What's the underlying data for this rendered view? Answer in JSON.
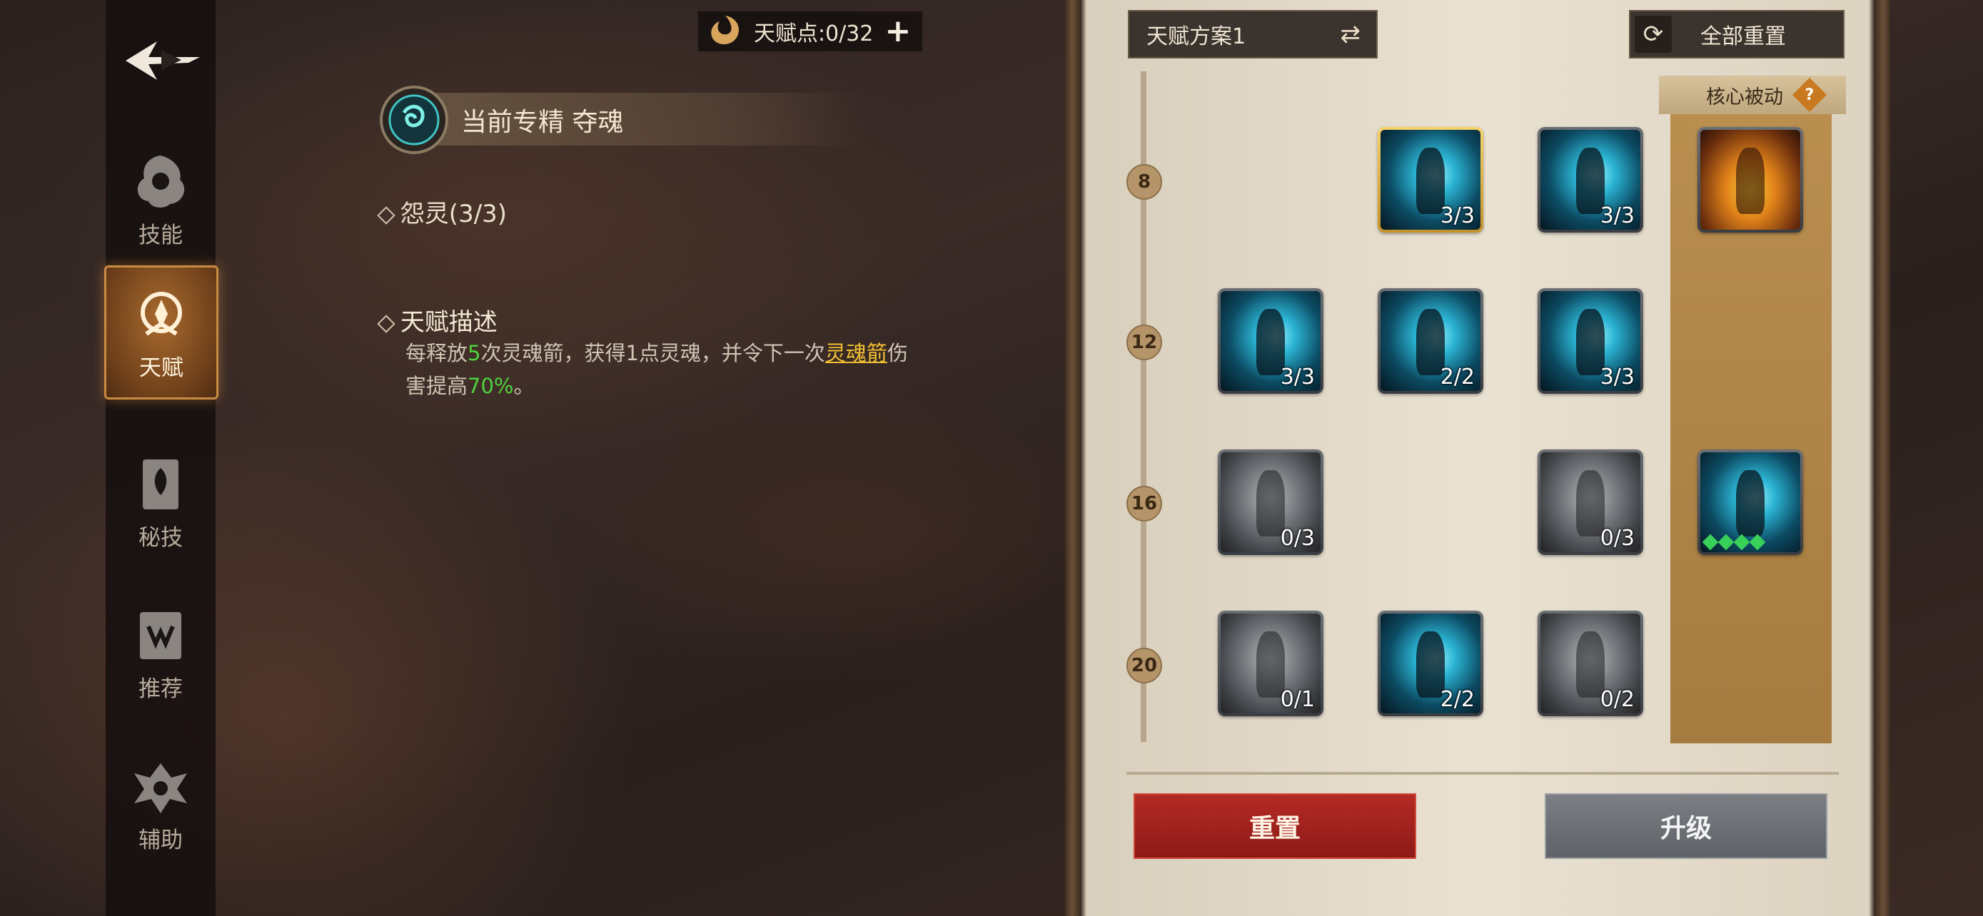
{
  "header": {
    "talent_points_label": "天赋点:0/32",
    "add_icon": "plus-icon"
  },
  "nav": {
    "back_icon": "back-arrow-icon",
    "items": [
      {
        "label": "技能",
        "icon": "skill-icon"
      },
      {
        "label": "天赋",
        "icon": "talent-icon",
        "active": true
      },
      {
        "label": "秘技",
        "icon": "secret-book-icon"
      },
      {
        "label": "推荐",
        "icon": "recommend-icon"
      },
      {
        "label": "辅助",
        "icon": "assist-icon"
      }
    ]
  },
  "spec": {
    "title": "当前专精 夺魂"
  },
  "talent": {
    "name": "怨灵(3/3)",
    "desc_header": "天赋描述",
    "desc_parts": {
      "p1": "每释放",
      "n1": "5",
      "p2": "次灵魂箭，获得1点灵魂，并令下一次",
      "link": "灵魂箭",
      "p3": "伤害提高",
      "n2": "70%",
      "p4": "。"
    }
  },
  "panel": {
    "plan_label": "天赋方案1",
    "reset_all_label": "全部重置",
    "core_passive_label": "核心被动",
    "levels": [
      "8",
      "12",
      "16",
      "20"
    ],
    "rows": [
      {
        "nodes": [
          null,
          {
            "count": "3/3",
            "state": "lit",
            "selected": true
          },
          {
            "count": "3/3",
            "state": "lit"
          }
        ],
        "core": {
          "state": "fire"
        }
      },
      {
        "nodes": [
          {
            "count": "3/3",
            "state": "lit"
          },
          {
            "count": "2/2",
            "state": "lit"
          },
          {
            "count": "3/3",
            "state": "lit"
          }
        ],
        "core": null
      },
      {
        "nodes": [
          {
            "count": "0/3",
            "state": "dim"
          },
          null,
          {
            "count": "0/3",
            "state": "dim"
          }
        ],
        "core": {
          "state": "lit",
          "gems": 4
        }
      },
      {
        "nodes": [
          {
            "count": "0/1",
            "state": "dim"
          },
          {
            "count": "2/2",
            "state": "lit"
          },
          {
            "count": "0/2",
            "state": "dim"
          }
        ],
        "core": null
      }
    ],
    "reset_button": "重置",
    "upgrade_button": "升级"
  },
  "colors": {
    "accent_green": "#4fd23d",
    "accent_yellow": "#f2c034",
    "reset_red": "#a42420",
    "upgrade_gray": "#6f7378"
  }
}
